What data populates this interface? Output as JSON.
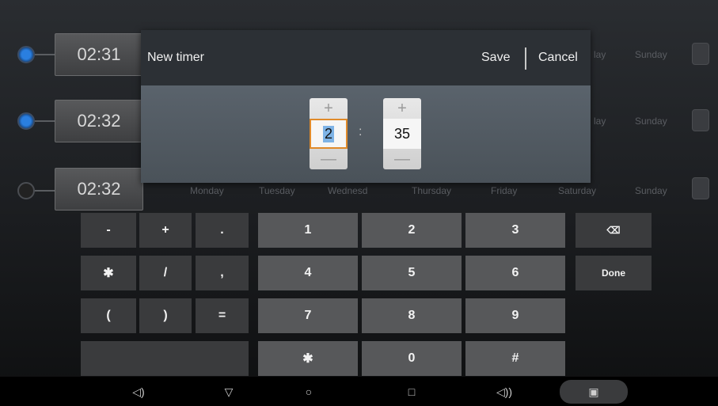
{
  "timers": [
    {
      "time": "02:31",
      "enabled": true,
      "days_visible": [
        "",
        "",
        "",
        "",
        "",
        "",
        "lay",
        "Sunday"
      ]
    },
    {
      "time": "02:32",
      "enabled": true,
      "days_visible": [
        "lay",
        "Sunday"
      ]
    },
    {
      "time": "02:32",
      "enabled": false,
      "days": [
        "Monday",
        "Tuesday",
        "Wednesd",
        "Thursday",
        "Friday",
        "Saturday",
        "Sunday"
      ]
    }
  ],
  "row1": {
    "time": "02:31",
    "day_partial": "lay",
    "day_last": "Sunday"
  },
  "row2": {
    "time": "02:32",
    "day_partial": "lay",
    "day_last": "Sunday"
  },
  "row3": {
    "time": "02:32",
    "days": [
      "Monday",
      "Tuesday",
      "Wednesd",
      "Thursday",
      "Friday",
      "Saturday",
      "Sunday"
    ]
  },
  "dialog": {
    "title": "New timer",
    "save_label": "Save",
    "cancel_label": "Cancel",
    "hours": {
      "plus": "+",
      "value": "2",
      "minus": "—"
    },
    "separator": ":",
    "minutes": {
      "plus": "+",
      "value": "35",
      "minus": "—"
    }
  },
  "keyboard": {
    "row1": [
      "-",
      "+",
      ".",
      "1",
      "2",
      "3",
      "⌫"
    ],
    "row2": [
      "✱",
      "/",
      ",",
      "4",
      "5",
      "6",
      "Done"
    ],
    "row3": [
      "(",
      ")",
      "=",
      "7",
      "8",
      "9"
    ],
    "row4": [
      "",
      "✱",
      "0",
      "#"
    ]
  },
  "navbar": {
    "vol_down": "◁)",
    "back": "▽",
    "home": "○",
    "recents": "□",
    "vol_up": "◁))",
    "screenshot": "▣"
  },
  "colors": {
    "accent_blue": "#2a7fe0",
    "focus_orange": "#e08a2a",
    "dialog_header": "#2c3035",
    "dialog_body": "#505860"
  }
}
